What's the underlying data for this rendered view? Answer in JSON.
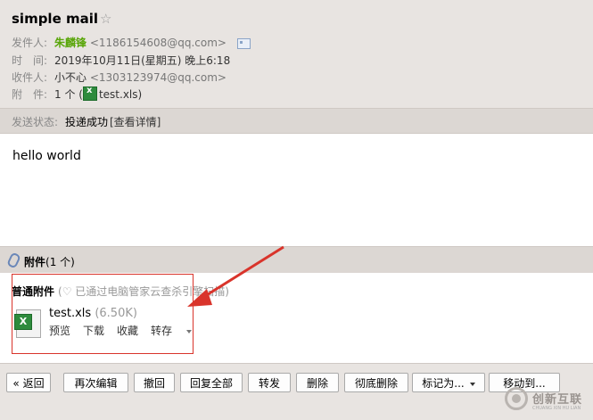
{
  "header": {
    "subject": "simple mail",
    "star": "☆",
    "from_label": "发件人:",
    "from_name": "朱麟锋",
    "from_addr": "<1186154608@qq.com>",
    "time_label": "时　间:",
    "time_value": "2019年10月11日(星期五) 晚上6:18",
    "to_label": "收件人:",
    "to_name": "小不心",
    "to_addr": "<1303123974@qq.com>",
    "att_label": "附　件:",
    "att_count": "1 个 (",
    "att_file": "test.xls",
    "att_close": ")"
  },
  "status": {
    "label": "发送状态:",
    "value": "投递成功",
    "detail": "[查看详情]"
  },
  "body": {
    "text": "hello world"
  },
  "attachments": {
    "title": "附件",
    "count": "(1 个)",
    "section_label": "普通附件",
    "safe_note": "(♡ 已通过电脑管家云查杀引擎扫描)",
    "file": {
      "icon": "excel-file-icon",
      "name": "test.xls",
      "size": "(6.50K)",
      "actions": [
        "预览",
        "下载",
        "收藏",
        "转存"
      ]
    }
  },
  "toolbar": {
    "back": "« 返回",
    "reedit": "再次编辑",
    "recall": "撤回",
    "reply_all": "回复全部",
    "forward": "转发",
    "delete": "删除",
    "delete_perm": "彻底删除",
    "mark_as": "标记为...",
    "move_to": "移动到..."
  },
  "watermark": {
    "text": "创新互联",
    "sub": "CHUANG XIN HU LIAN"
  },
  "colors": {
    "header_bg": "#e8e4e1",
    "sender_green": "#5aa60a",
    "highlight_red": "#d9342b"
  }
}
